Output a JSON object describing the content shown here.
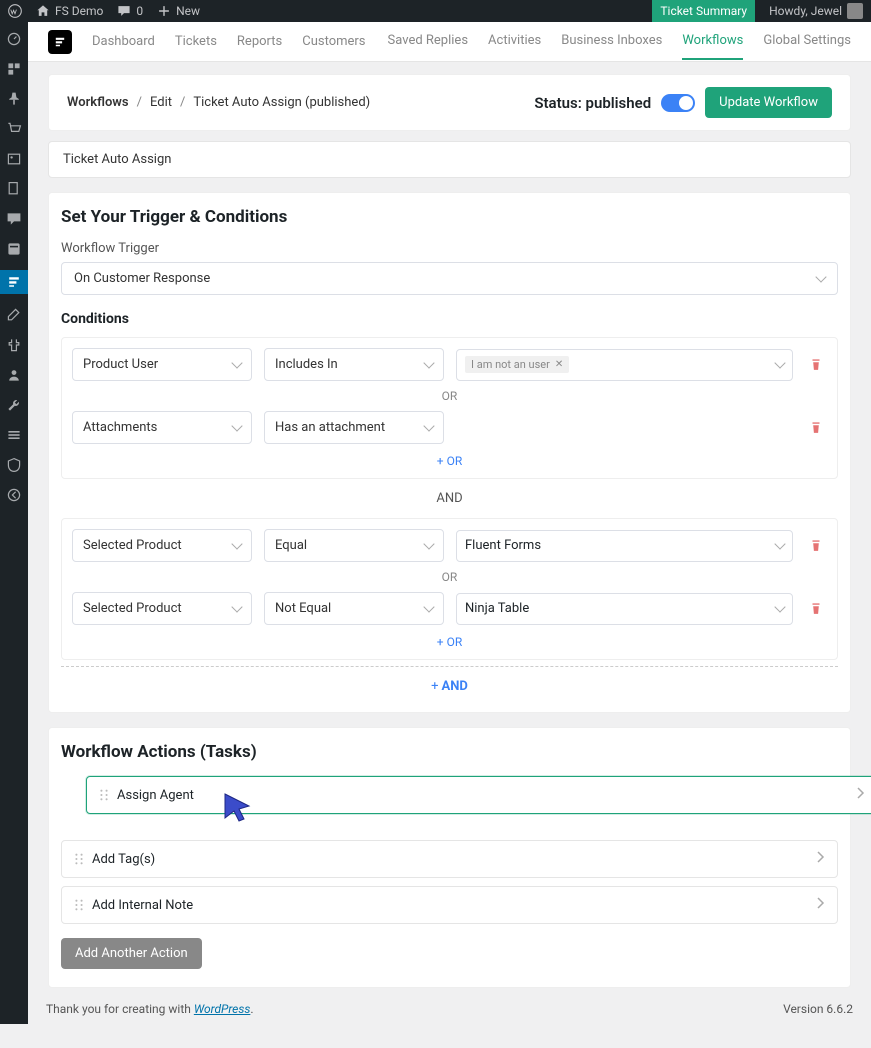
{
  "adminbar": {
    "site_name": "FS Demo",
    "comments": "0",
    "new_label": "New",
    "ticket_summary": "Ticket Summary",
    "howdy": "Howdy, Jewel"
  },
  "nav": {
    "left": [
      "Dashboard",
      "Tickets",
      "Reports",
      "Customers"
    ],
    "right": [
      "Saved Replies",
      "Activities",
      "Business Inboxes",
      "Workflows",
      "Global Settings"
    ],
    "active": "Workflows"
  },
  "breadcrumb": {
    "items": [
      "Workflows",
      "Edit",
      "Ticket Auto Assign (published)"
    ]
  },
  "status": {
    "label": "Status: published",
    "button": "Update Workflow"
  },
  "workflow_title": "Ticket Auto Assign",
  "trigger_section": {
    "title": "Set Your Trigger & Conditions",
    "trigger_label": "Workflow Trigger",
    "trigger_value": "On Customer Response",
    "conditions_label": "Conditions"
  },
  "groups": [
    {
      "rows": [
        {
          "field": "Product User",
          "operator": "Includes In",
          "value_tag": "I am not an user",
          "value_type": "tag"
        },
        {
          "field": "Attachments",
          "operator": "Has an attachment",
          "value_type": "none"
        }
      ]
    },
    {
      "rows": [
        {
          "field": "Selected Product",
          "operator": "Equal",
          "value": "Fluent Forms",
          "value_type": "select"
        },
        {
          "field": "Selected Product",
          "operator": "Not Equal",
          "value": "Ninja Table",
          "value_type": "select"
        }
      ]
    }
  ],
  "connectors": {
    "or": "OR",
    "and": "AND",
    "add_or": "OR",
    "add_and": "AND"
  },
  "actions": {
    "title": "Workflow Actions (Tasks)",
    "items": [
      "Assign Agent",
      "Add Tag(s)",
      "Add Internal Note"
    ],
    "add_button": "Add Another Action"
  },
  "footer": {
    "credit_prefix": "Thank you for creating with ",
    "credit_link": "WordPress",
    "version": "Version 6.6.2"
  }
}
